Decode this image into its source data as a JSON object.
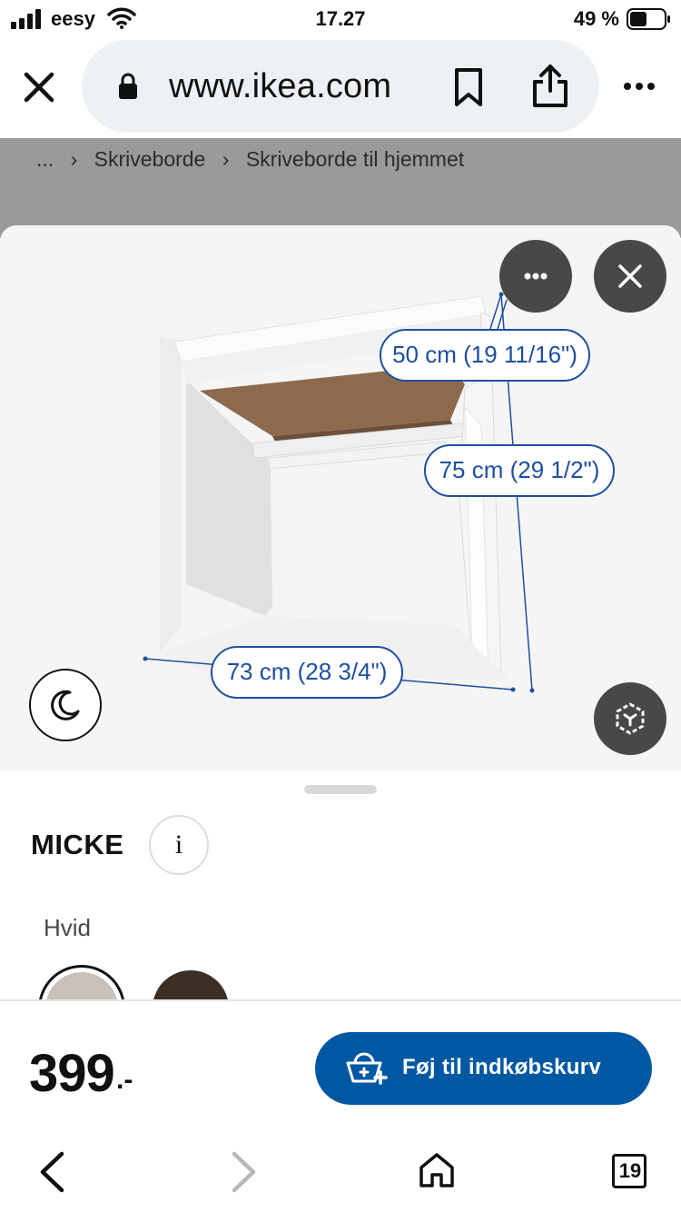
{
  "status_bar": {
    "carrier": "eesy",
    "time": "17.27",
    "battery_percent": "49 %"
  },
  "browser": {
    "url": "www.ikea.com",
    "tabs_count": "19"
  },
  "breadcrumb": [
    "...",
    "Skriveborde",
    "Skriveborde til hjemmet"
  ],
  "viewer": {
    "dimensions": {
      "depth": "50 cm (19 11/16\")",
      "height": "75 cm (29 1/2\")",
      "width": "73 cm (28 3/4\")"
    }
  },
  "product": {
    "name": "MICKE",
    "info_label": "i",
    "color_label": "Hvid",
    "swatches": [
      "#c9c2bb",
      "#3d2e25"
    ]
  },
  "purchase": {
    "price": "399",
    "price_suffix": ".-",
    "add_to_cart_label": "Føj til indkøbskurv"
  },
  "colors": {
    "accent": "#0058a3",
    "dimension_label": "#1e4fa0",
    "viewer_button": "#484848"
  }
}
